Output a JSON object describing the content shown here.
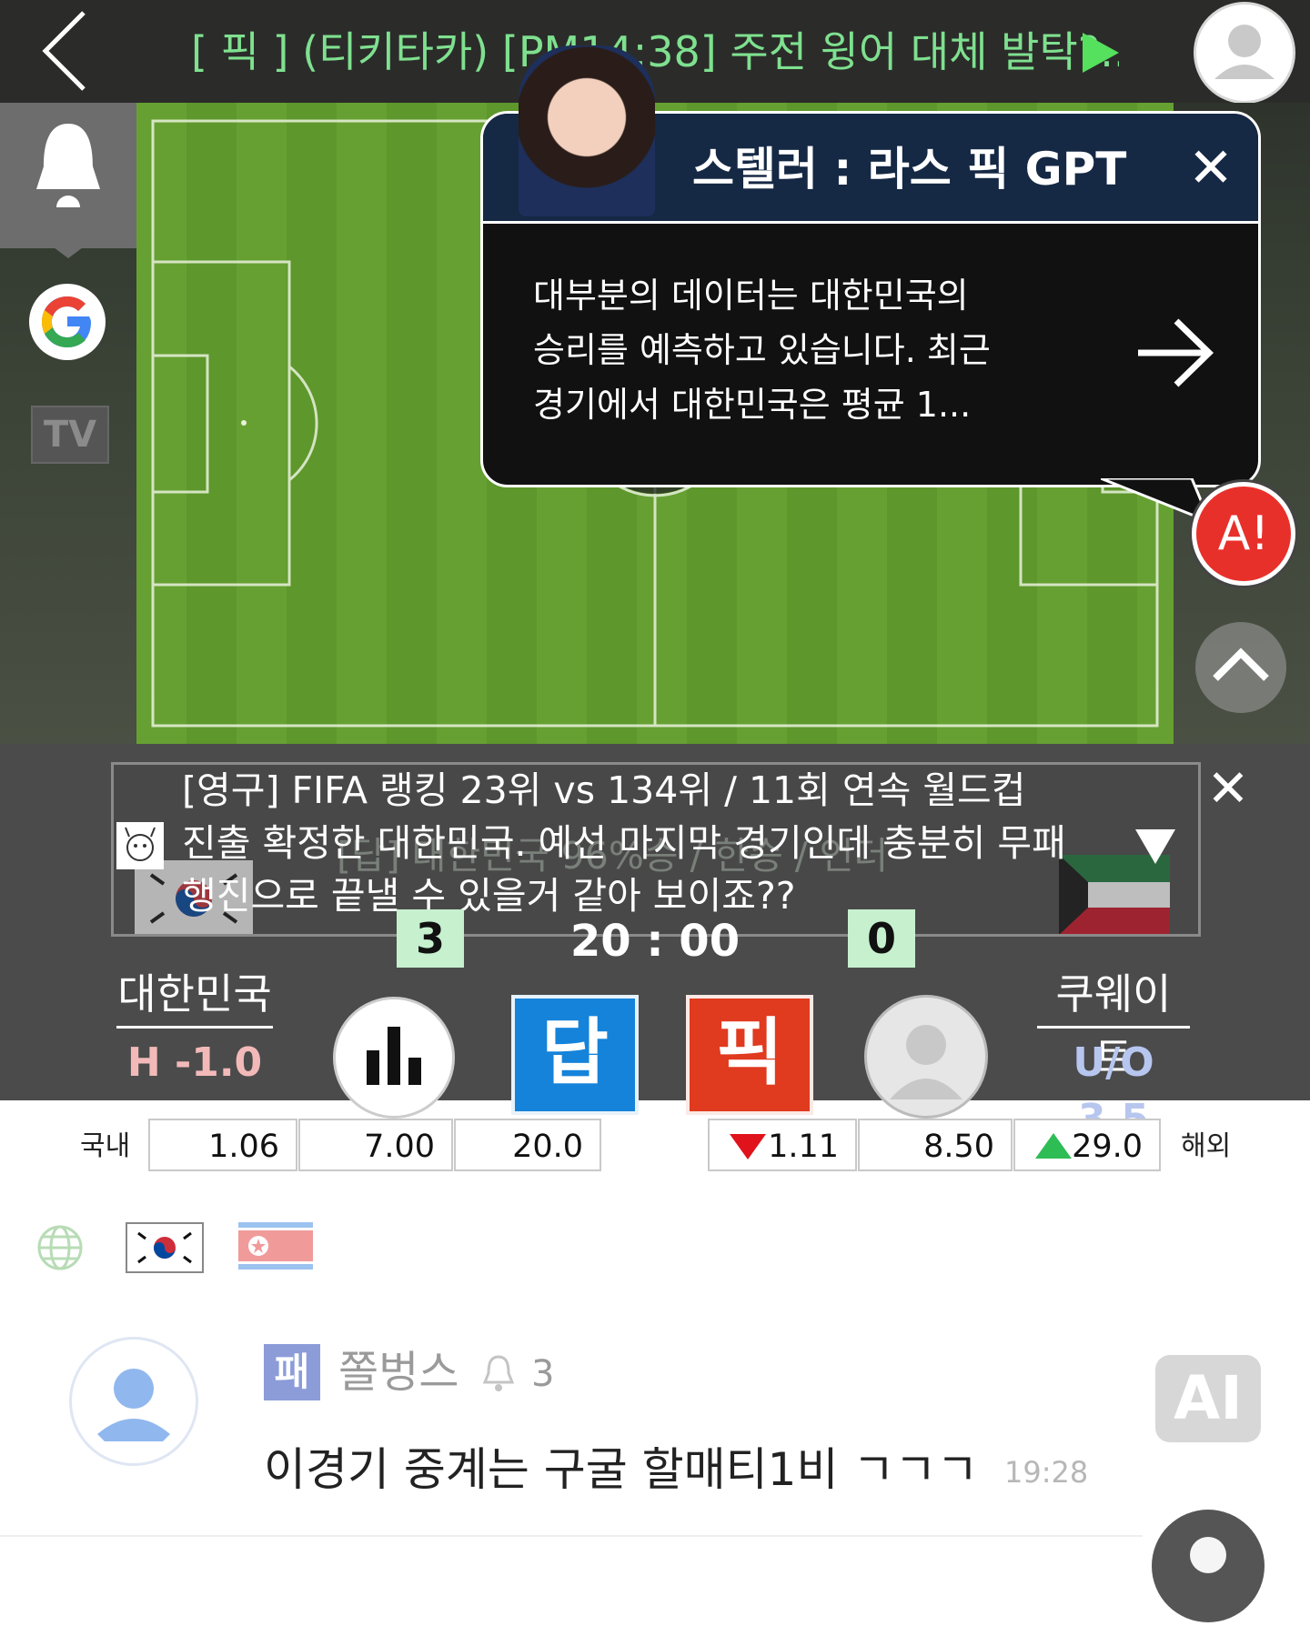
{
  "header": {
    "back_icon": "chevron-left-icon",
    "headline": "[ 픽 ]  (티키타카) [PM14:38] 주전 윙어 대체 발탁?...",
    "play_icon": "play-triangle-icon",
    "profile_icon": "user-icon"
  },
  "sidebar": {
    "bell_icon": "bell-icon",
    "google_icon": "google-icon",
    "tv_label": "TV"
  },
  "gpt_popup": {
    "title": "스텔러 : 라스 픽 GPT",
    "close": "✕",
    "body_lines": [
      "대부분의 데이터는 대한민국의",
      "승리를 예측하고 있습니다. 최근",
      "경기에서 대한민국은 평균 1..."
    ],
    "arrow_icon": "arrow-right-icon"
  },
  "alert_button": {
    "label": "A!"
  },
  "news": {
    "lines": [
      "[영구] FIFA 랭킹 23위 vs 134위 / 11회 연속 월드컵",
      "진출 확정한 대한민국. 예선 마지막 경기인데 충분히 무패",
      "행진으로 끝낼 수 있을거 같아 보이죠??"
    ],
    "ghost": "[답] 대한민국 96%승 / 한승 / 언더",
    "close": "✕"
  },
  "match": {
    "home_team": "대한민국",
    "away_team": "쿠웨이트",
    "home_score": "3",
    "away_score": "0",
    "time": "20 : 00",
    "handicap": "H -1.0",
    "under_over": "U/O 3.5",
    "dap_label": "답",
    "pick_label": "픽"
  },
  "odds": {
    "domestic_label": "국내",
    "overseas_label": "해외",
    "domestic": [
      "1.06",
      "7.00",
      "20.0"
    ],
    "overseas": [
      "1.11",
      "8.50",
      "29.0"
    ],
    "overseas_trend": [
      "down",
      "none",
      "up"
    ],
    "colors": {
      "down": "#e0121c",
      "up": "#2ebd55"
    }
  },
  "chat": {
    "badge": "패",
    "nickname": "쫄벙스",
    "bell_count": "3",
    "message": "이경기 중계는 구굴 할매티1비 ㄱㄱㄱ",
    "time": "19:28",
    "ai_label": "AI"
  },
  "colors": {
    "accent_green": "#7fe08f",
    "header_bg": "#152844",
    "dap": "#1583d9",
    "pick": "#e03a1f"
  }
}
